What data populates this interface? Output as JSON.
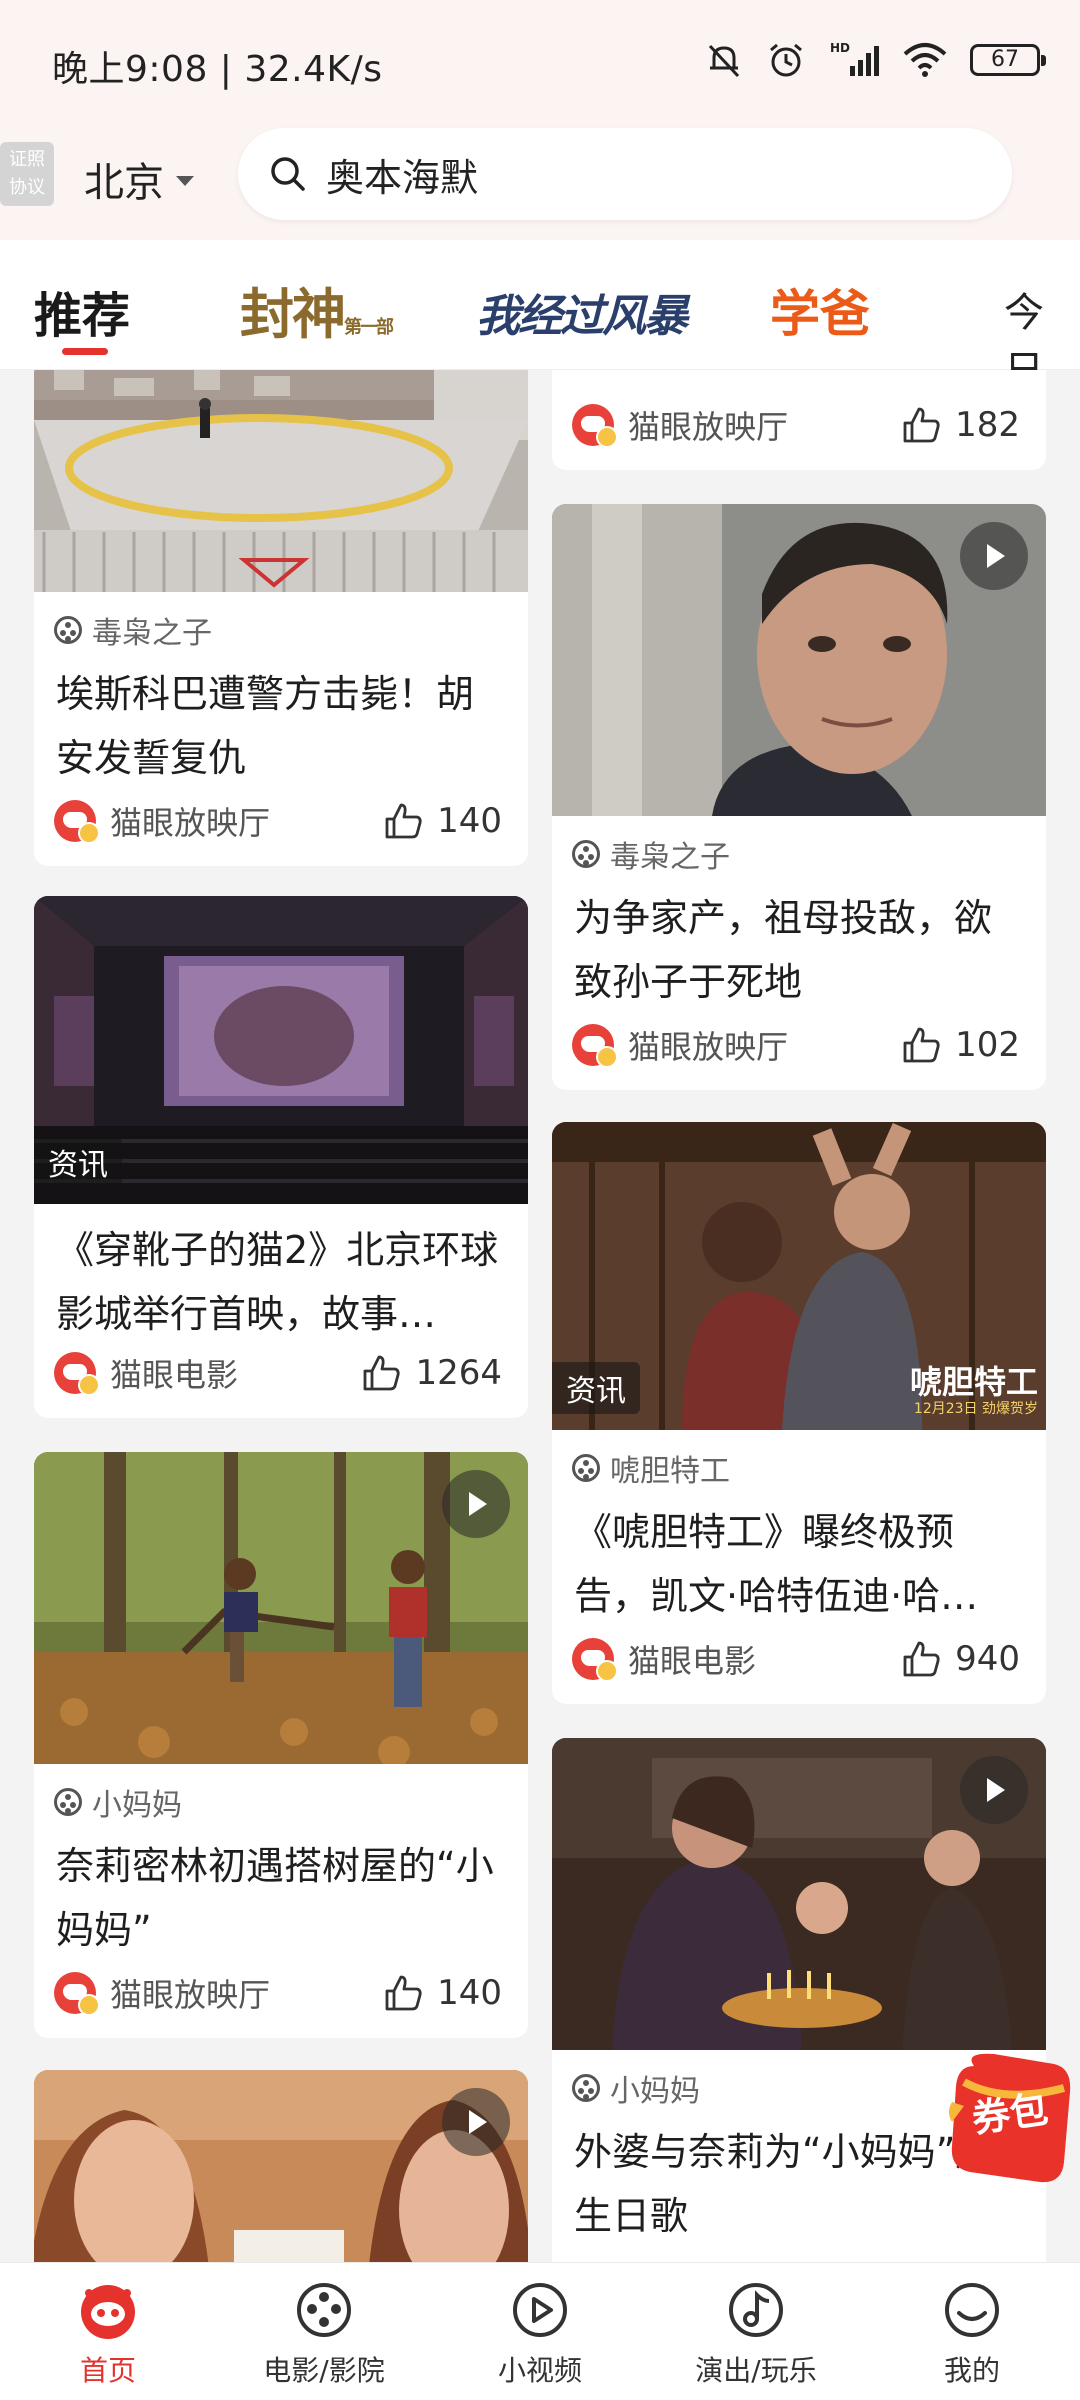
{
  "status_bar": {
    "time": "晚上9:08 | 32.4K/s",
    "battery": "67"
  },
  "header": {
    "cert_badge": "证照\n协议",
    "city": "北京",
    "search_text": "奥本海默"
  },
  "tabs": {
    "recommend": "推荐",
    "logo1": "封神",
    "logo1_sub": "第一部",
    "logo2": "我经过风暴",
    "logo3": "学爸",
    "today": "今日"
  },
  "cards": [
    {
      "film": "",
      "title": "",
      "source": "猫眼放映厅",
      "likes": "182"
    },
    {
      "film": "毒枭之子",
      "title": "埃斯科巴遭警方击毙！胡安发誓复仇",
      "source": "猫眼放映厅",
      "likes": "140"
    },
    {
      "film": "毒枭之子",
      "title": "为争家产，祖母投敌，欲致孙子于死地",
      "source": "猫眼放映厅",
      "likes": "102"
    },
    {
      "tag": "资讯",
      "title": "《穿靴子的猫2》北京环球影城举行首映，故事…",
      "source": "猫眼电影",
      "likes": "1264"
    },
    {
      "tag": "资讯",
      "film": "唬胆特工",
      "title": "《唬胆特工》曝终极预告，凯文·哈特伍迪·哈…",
      "source": "猫眼电影",
      "likes": "940",
      "poster_text": "唬胆特工",
      "poster_sub": "12月23日 劲爆贺岁"
    },
    {
      "film": "小妈妈",
      "title": "奈莉密林初遇搭树屋的“小妈妈”",
      "source": "猫眼放映厅",
      "likes": "140"
    },
    {
      "film": "小妈妈",
      "title": "外婆与奈莉为“小妈妈”起生日歌",
      "source": "",
      "likes": ""
    },
    {
      "film": "",
      "title": "",
      "source": "",
      "likes": ""
    }
  ],
  "coupon": {
    "label": "券包"
  },
  "bottom_nav": [
    {
      "label": "首页",
      "active": true
    },
    {
      "label": "电影/影院",
      "active": false
    },
    {
      "label": "小视频",
      "active": false
    },
    {
      "label": "演出/玩乐",
      "active": false
    },
    {
      "label": "我的",
      "active": false
    }
  ],
  "colors": {
    "accent": "#e5322d",
    "background": "#f3f3f3",
    "header_bg": "#fbf4f2"
  }
}
